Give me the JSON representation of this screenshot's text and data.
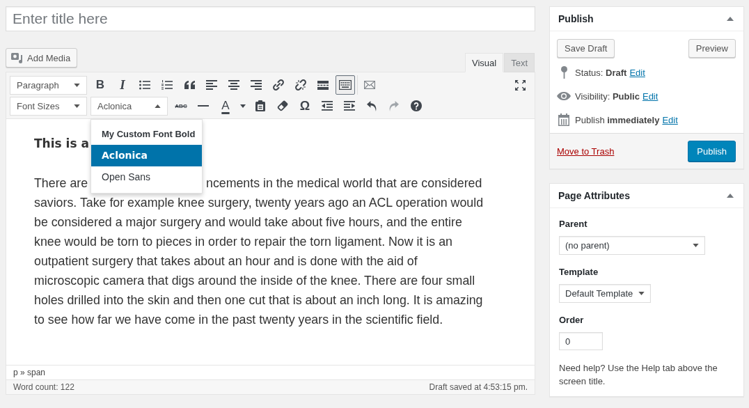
{
  "title_field": {
    "placeholder": "Enter title here"
  },
  "add_media_button": {
    "label": "Add Media"
  },
  "editor_tabs": [
    {
      "label": "Visual",
      "selected": true
    },
    {
      "label": "Text",
      "selected": false
    }
  ],
  "toolbar_rows": [
    {
      "selects": [
        {
          "value": "Paragraph",
          "open": false
        }
      ],
      "button_groups": [
        [
          {
            "kind": "bold",
            "text": "B",
            "pressed": false,
            "disabled": false
          },
          {
            "kind": "italic",
            "text": "I",
            "pressed": false,
            "disabled": false
          },
          {
            "kind": "bullets",
            "pressed": false,
            "disabled": false
          },
          {
            "kind": "numbers",
            "pressed": false,
            "disabled": false
          },
          {
            "kind": "quote",
            "pressed": false,
            "disabled": false
          },
          {
            "kind": "alignleft",
            "pressed": false,
            "disabled": false
          },
          {
            "kind": "aligncenter",
            "pressed": false,
            "disabled": false
          },
          {
            "kind": "alignright",
            "pressed": false,
            "disabled": false
          },
          {
            "kind": "link",
            "pressed": false,
            "disabled": false
          },
          {
            "kind": "unlink",
            "pressed": false,
            "disabled": false
          },
          {
            "kind": "readmore",
            "pressed": false,
            "disabled": false
          },
          {
            "kind": "toolbar",
            "pressed": true,
            "disabled": false
          }
        ],
        [
          {
            "kind": "mail",
            "pressed": false,
            "disabled": false
          }
        ]
      ],
      "end_buttons": [
        {
          "kind": "fullscreen",
          "pressed": false,
          "disabled": false
        }
      ]
    },
    {
      "selects": [
        {
          "value": "Font Sizes",
          "open": false
        },
        {
          "value": "Aclonica",
          "open": true,
          "options": [
            {
              "label": "My Custom Font Bold",
              "kind": "bold",
              "selected": false
            },
            {
              "label": "Aclonica",
              "kind": "decorative",
              "selected": true
            },
            {
              "label": "Open Sans",
              "kind": "plain",
              "selected": false
            }
          ]
        }
      ],
      "button_groups": [
        [
          {
            "kind": "strike",
            "text": "ABC",
            "pressed": false,
            "disabled": false
          },
          {
            "kind": "hr",
            "pressed": false,
            "disabled": false
          },
          {
            "kind": "textcolor",
            "text": "A",
            "pressed": false,
            "disabled": false
          },
          {
            "kind": "colormenu",
            "pressed": false,
            "disabled": false
          },
          {
            "kind": "paste",
            "pressed": false,
            "disabled": false
          },
          {
            "kind": "eraser",
            "pressed": false,
            "disabled": false
          },
          {
            "kind": "omega",
            "text": "Ω",
            "pressed": false,
            "disabled": false
          },
          {
            "kind": "outdent",
            "pressed": false,
            "disabled": false
          },
          {
            "kind": "indent",
            "pressed": false,
            "disabled": false
          },
          {
            "kind": "undo",
            "pressed": false,
            "disabled": false
          },
          {
            "kind": "redo",
            "pressed": false,
            "disabled": true
          },
          {
            "kind": "help",
            "pressed": false,
            "disabled": false
          }
        ]
      ]
    }
  ],
  "content": {
    "heading": "This is a",
    "paragraph_lines": [
      {
        "parts": [
          "There are",
          "ncements in the medical world that are considered"
        ]
      },
      {
        "parts": [
          "saviors. Take for example knee surgery, twenty years ago an ACL operation would"
        ]
      },
      {
        "parts": [
          "be considered a major surgery and would take about five hours, and the entire"
        ]
      },
      {
        "parts": [
          "knee would be torn to pieces in order to repair the torn ligament. Now it is an"
        ]
      },
      {
        "parts": [
          "outpatient surgery that takes about an hour and is done with the aid of"
        ]
      },
      {
        "parts": [
          "microscopic camera that digs around the inside of the knee. There are four small"
        ]
      },
      {
        "parts": [
          "holes drilled into the skin and then one cut that is about an inch long. It is amazing"
        ]
      },
      {
        "parts": [
          "to see how far we have come in the past twenty years in the scientific field."
        ]
      }
    ]
  },
  "element_path": "p » span",
  "status_bar": {
    "word_count": "Word count: 122",
    "autosave": "Draft saved at 4:53:15 pm."
  },
  "publish_box": {
    "title": "Publish",
    "expanded": true,
    "save_draft_button": "Save Draft",
    "preview_button": "Preview",
    "rows": [
      {
        "kind": "status",
        "text": "Status: **Draft**",
        "link": "Edit"
      },
      {
        "kind": "visibility",
        "text": "Visibility: **Public**",
        "link": "Edit"
      },
      {
        "kind": "schedule",
        "text": "Publish **immediately**",
        "link": "Edit"
      }
    ],
    "trash_link": "Move to Trash",
    "publish_button": "Publish"
  },
  "page_attributes": {
    "title": "Page Attributes",
    "expanded": true,
    "fields": [
      {
        "kind": "select",
        "label": "Parent",
        "value": "(no parent)"
      },
      {
        "kind": "select",
        "label": "Template",
        "value": "Default Template"
      },
      {
        "kind": "input",
        "label": "Order",
        "value": "0"
      }
    ],
    "help": "Need help? Use the Help tab above the screen title."
  }
}
